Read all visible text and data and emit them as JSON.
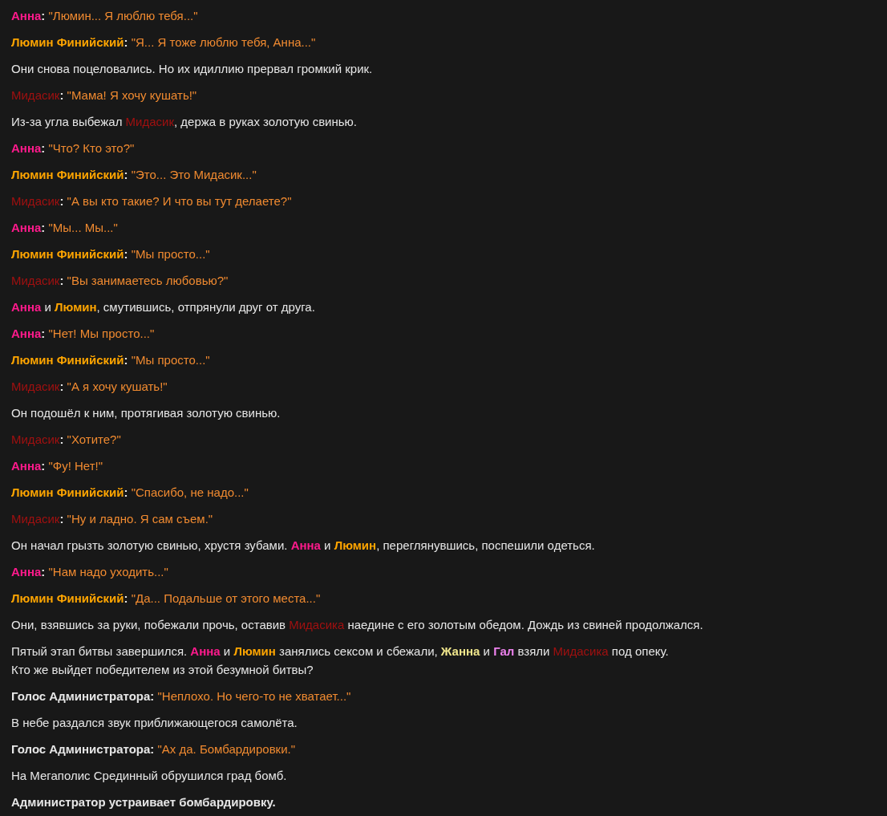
{
  "lines": [
    {
      "segments": [
        {
          "kind": "name",
          "text": "Анна",
          "color": "#ff1a8c",
          "bold": true
        },
        {
          "kind": "plain",
          "text": ": ",
          "bold": true
        },
        {
          "kind": "quote",
          "text": "\"Люмин... Я люблю тебя...\""
        }
      ]
    },
    {
      "segments": [
        {
          "kind": "name",
          "text": "Люмин Финийский",
          "color": "#ffa500",
          "bold": true
        },
        {
          "kind": "plain",
          "text": ": ",
          "bold": true
        },
        {
          "kind": "quote",
          "text": "\"Я... Я тоже люблю тебя, Анна...\""
        }
      ]
    },
    {
      "segments": [
        {
          "kind": "plain",
          "text": "Они снова поцеловались. Но их идиллию прервал громкий крик.",
          "bold": false
        }
      ]
    },
    {
      "segments": [
        {
          "kind": "name",
          "text": "Мидасик",
          "color": "#a01010",
          "bold": false
        },
        {
          "kind": "plain",
          "text": ": ",
          "bold": true
        },
        {
          "kind": "quote",
          "text": "\"Мама! Я хочу кушать!\""
        }
      ]
    },
    {
      "segments": [
        {
          "kind": "plain",
          "text": "Из-за угла выбежал ",
          "bold": false
        },
        {
          "kind": "name",
          "text": "Мидасик",
          "color": "#a01010",
          "bold": false
        },
        {
          "kind": "plain",
          "text": ", держа в руках золотую свинью.",
          "bold": false
        }
      ]
    },
    {
      "segments": [
        {
          "kind": "name",
          "text": "Анна",
          "color": "#ff1a8c",
          "bold": true
        },
        {
          "kind": "plain",
          "text": ": ",
          "bold": true
        },
        {
          "kind": "quote",
          "text": "\"Что? Кто это?\""
        }
      ]
    },
    {
      "segments": [
        {
          "kind": "name",
          "text": "Люмин Финийский",
          "color": "#ffa500",
          "bold": true
        },
        {
          "kind": "plain",
          "text": ": ",
          "bold": true
        },
        {
          "kind": "quote",
          "text": "\"Это... Это Мидасик...\""
        }
      ]
    },
    {
      "segments": [
        {
          "kind": "name",
          "text": "Мидасик",
          "color": "#a01010",
          "bold": false
        },
        {
          "kind": "plain",
          "text": ": ",
          "bold": true
        },
        {
          "kind": "quote",
          "text": "\"А вы кто такие? И что вы тут делаете?\""
        }
      ]
    },
    {
      "segments": [
        {
          "kind": "name",
          "text": "Анна",
          "color": "#ff1a8c",
          "bold": true
        },
        {
          "kind": "plain",
          "text": ": ",
          "bold": true
        },
        {
          "kind": "quote",
          "text": "\"Мы... Мы...\""
        }
      ]
    },
    {
      "segments": [
        {
          "kind": "name",
          "text": "Люмин Финийский",
          "color": "#ffa500",
          "bold": true
        },
        {
          "kind": "plain",
          "text": ": ",
          "bold": true
        },
        {
          "kind": "quote",
          "text": "\"Мы просто...\""
        }
      ]
    },
    {
      "segments": [
        {
          "kind": "name",
          "text": "Мидасик",
          "color": "#a01010",
          "bold": false
        },
        {
          "kind": "plain",
          "text": ": ",
          "bold": true
        },
        {
          "kind": "quote",
          "text": "\"Вы занимаетесь любовью?\""
        }
      ]
    },
    {
      "segments": [
        {
          "kind": "name",
          "text": "Анна",
          "color": "#ff1a8c",
          "bold": true
        },
        {
          "kind": "plain",
          "text": " и ",
          "bold": false
        },
        {
          "kind": "name",
          "text": "Люмин",
          "color": "#ffa500",
          "bold": true
        },
        {
          "kind": "plain",
          "text": ", смутившись, отпрянули друг от друга.",
          "bold": false
        }
      ]
    },
    {
      "segments": [
        {
          "kind": "name",
          "text": "Анна",
          "color": "#ff1a8c",
          "bold": true
        },
        {
          "kind": "plain",
          "text": ": ",
          "bold": true
        },
        {
          "kind": "quote",
          "text": "\"Нет! Мы просто...\""
        }
      ]
    },
    {
      "segments": [
        {
          "kind": "name",
          "text": "Люмин Финийский",
          "color": "#ffa500",
          "bold": true
        },
        {
          "kind": "plain",
          "text": ": ",
          "bold": true
        },
        {
          "kind": "quote",
          "text": "\"Мы просто...\""
        }
      ]
    },
    {
      "segments": [
        {
          "kind": "name",
          "text": "Мидасик",
          "color": "#a01010",
          "bold": false
        },
        {
          "kind": "plain",
          "text": ": ",
          "bold": true
        },
        {
          "kind": "quote",
          "text": "\"А я хочу кушать!\""
        }
      ]
    },
    {
      "segments": [
        {
          "kind": "plain",
          "text": "Он подошёл к ним, протягивая золотую свинью.",
          "bold": false
        }
      ]
    },
    {
      "segments": [
        {
          "kind": "name",
          "text": "Мидасик",
          "color": "#a01010",
          "bold": false
        },
        {
          "kind": "plain",
          "text": ": ",
          "bold": true
        },
        {
          "kind": "quote",
          "text": "\"Хотите?\""
        }
      ]
    },
    {
      "segments": [
        {
          "kind": "name",
          "text": "Анна",
          "color": "#ff1a8c",
          "bold": true
        },
        {
          "kind": "plain",
          "text": ": ",
          "bold": true
        },
        {
          "kind": "quote",
          "text": "\"Фу! Нет!\""
        }
      ]
    },
    {
      "segments": [
        {
          "kind": "name",
          "text": "Люмин Финийский",
          "color": "#ffa500",
          "bold": true
        },
        {
          "kind": "plain",
          "text": ": ",
          "bold": true
        },
        {
          "kind": "quote",
          "text": "\"Спасибо, не надо...\""
        }
      ]
    },
    {
      "segments": [
        {
          "kind": "name",
          "text": "Мидасик",
          "color": "#a01010",
          "bold": false
        },
        {
          "kind": "plain",
          "text": ": ",
          "bold": true
        },
        {
          "kind": "quote",
          "text": "\"Ну и ладно. Я сам съем.\""
        }
      ]
    },
    {
      "segments": [
        {
          "kind": "plain",
          "text": "Он начал грызть золотую свинью, хрустя зубами. ",
          "bold": false
        },
        {
          "kind": "name",
          "text": "Анна",
          "color": "#ff1a8c",
          "bold": true
        },
        {
          "kind": "plain",
          "text": " и ",
          "bold": false
        },
        {
          "kind": "name",
          "text": "Люмин",
          "color": "#ffa500",
          "bold": true
        },
        {
          "kind": "plain",
          "text": ", переглянувшись, поспешили одеться.",
          "bold": false
        }
      ]
    },
    {
      "segments": [
        {
          "kind": "name",
          "text": "Анна",
          "color": "#ff1a8c",
          "bold": true
        },
        {
          "kind": "plain",
          "text": ": ",
          "bold": true
        },
        {
          "kind": "quote",
          "text": "\"Нам надо уходить...\""
        }
      ]
    },
    {
      "segments": [
        {
          "kind": "name",
          "text": "Люмин Финийский",
          "color": "#ffa500",
          "bold": true
        },
        {
          "kind": "plain",
          "text": ": ",
          "bold": true
        },
        {
          "kind": "quote",
          "text": "\"Да... Подальше от этого места...\""
        }
      ]
    },
    {
      "segments": [
        {
          "kind": "plain",
          "text": "Они, взявшись за руки, побежали прочь, оставив ",
          "bold": false
        },
        {
          "kind": "name",
          "text": "Мидасика",
          "color": "#a01010",
          "bold": false
        },
        {
          "kind": "plain",
          "text": " наедине с его золотым обедом. Дождь из свиней продолжался.",
          "bold": false
        }
      ]
    },
    {
      "segments": [
        {
          "kind": "plain",
          "text": "Пятый этап битвы завершился. ",
          "bold": false
        },
        {
          "kind": "name",
          "text": "Анна",
          "color": "#ff1a8c",
          "bold": true
        },
        {
          "kind": "plain",
          "text": " и ",
          "bold": false
        },
        {
          "kind": "name",
          "text": "Люмин",
          "color": "#ffa500",
          "bold": true
        },
        {
          "kind": "plain",
          "text": " занялись сексом и сбежали, ",
          "bold": false
        },
        {
          "kind": "name",
          "text": "Жанна",
          "color": "#f0e68c",
          "bold": true
        },
        {
          "kind": "plain",
          "text": " и ",
          "bold": false
        },
        {
          "kind": "name",
          "text": "Гал",
          "color": "#ee82ee",
          "bold": true
        },
        {
          "kind": "plain",
          "text": " взяли ",
          "bold": false
        },
        {
          "kind": "name",
          "text": "Мидасика",
          "color": "#a01010",
          "bold": false
        },
        {
          "kind": "plain",
          "text": " под опеку.\nКто же выйдет победителем из этой безумной битвы?",
          "bold": false
        }
      ]
    },
    {
      "segments": [
        {
          "kind": "plain",
          "text": "Голос Администратора: ",
          "bold": true
        },
        {
          "kind": "quote",
          "text": "\"Неплохо. Но чего-то не хватает...\""
        }
      ]
    },
    {
      "segments": [
        {
          "kind": "plain",
          "text": "В небе раздался звук приближающегося самолёта.",
          "bold": false
        }
      ]
    },
    {
      "segments": [
        {
          "kind": "plain",
          "text": "Голос Администратора: ",
          "bold": true
        },
        {
          "kind": "quote",
          "text": "\"Ах да. Бомбардировки.\""
        }
      ]
    },
    {
      "segments": [
        {
          "kind": "plain",
          "text": "На Мегаполис Срединный обрушился град бомб.",
          "bold": false
        }
      ]
    },
    {
      "segments": [
        {
          "kind": "plain",
          "text": "Администратор устраивает бомбардировку.",
          "bold": true
        }
      ]
    }
  ]
}
